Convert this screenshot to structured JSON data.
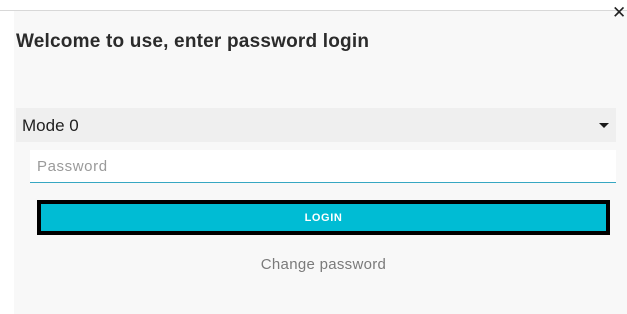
{
  "dialog": {
    "title": "Welcome to use, enter password login",
    "close_icon": "close-icon",
    "mode_select": {
      "selected": "Mode 0",
      "caret_icon": "caret-down-icon"
    },
    "password": {
      "value": "",
      "placeholder": "Password"
    },
    "login_label": "LOGIN",
    "change_password_label": "Change password"
  },
  "colors": {
    "accent": "#00bcd4",
    "underline": "#36a7c2",
    "dialog_background": "#f8f8f8"
  }
}
